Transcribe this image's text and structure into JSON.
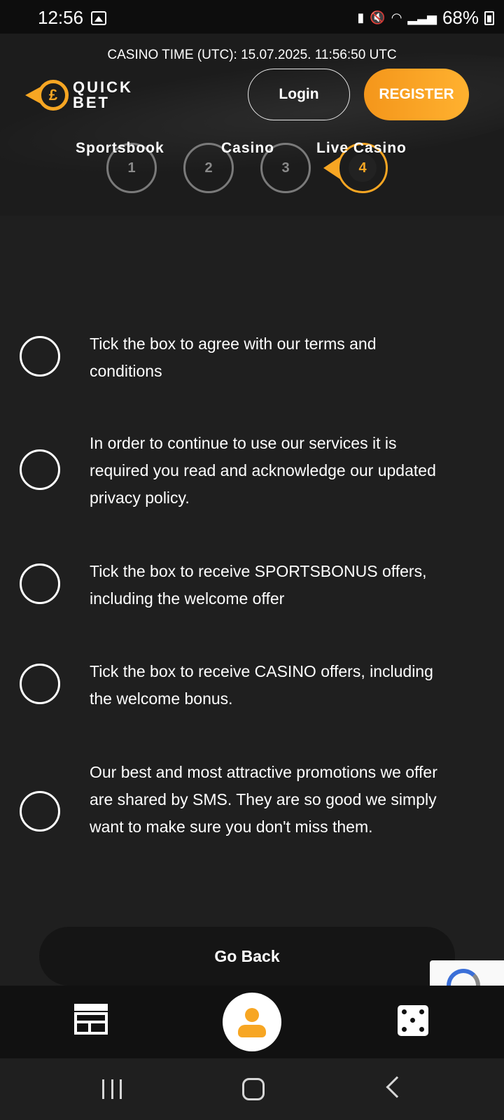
{
  "status_bar": {
    "time": "12:56",
    "battery": "68%"
  },
  "header": {
    "casino_time": "CASINO TIME (UTC): 15.07.2025. 11:56:50 UTC",
    "logo_line1": "QUICK",
    "logo_line2": "BET",
    "logo_symbol": "£",
    "login_label": "Login",
    "register_label": "REGISTER"
  },
  "steps": [
    {
      "label": "Sportsbook",
      "number": "1",
      "active": false
    },
    {
      "label": "Casino",
      "number": "2",
      "active": false
    },
    {
      "label": "Live Casino",
      "number": "4",
      "active": true
    },
    {
      "number": "3",
      "active": false
    }
  ],
  "consents": [
    {
      "text": "Tick the box to agree with our terms and conditions",
      "checked": false
    },
    {
      "text": "In order to continue to use our services it is required you read and acknowledge our updated privacy policy.",
      "checked": false
    },
    {
      "text": "Tick the box to receive SPORTSBONUS offers, including the welcome offer",
      "checked": false
    },
    {
      "text": "Tick the box to receive CASINO offers, including the welcome bonus.",
      "checked": false
    },
    {
      "text": "Our best and most attractive promotions we offer are shared by SMS. They are so good we simply want to make sure you don't miss them.",
      "checked": false
    }
  ],
  "go_back_label": "Go Back",
  "icons": {
    "bottom_nav": [
      "sportsbook-table-icon",
      "profile-icon",
      "dice-icon"
    ],
    "system_nav": [
      "recent-apps-icon",
      "home-icon",
      "back-icon"
    ]
  },
  "colors": {
    "accent": "#f7a623",
    "background": "#1f1f1f",
    "bottom_nav": "#111111"
  }
}
